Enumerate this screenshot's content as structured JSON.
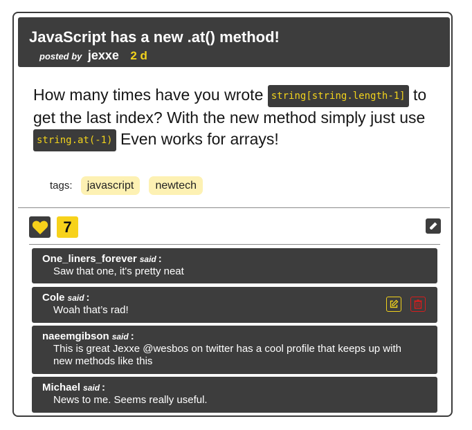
{
  "post": {
    "title": "JavaScript has a new .at() method!",
    "posted_by_label": "posted by",
    "author": "jexxe",
    "time_ago": "2 d",
    "body": {
      "part1": "How many times have you wrote ",
      "code1": "string[string.length-1]",
      "part2": " to get the last index? With the new method simply just use ",
      "code2": "string.at(-1)",
      "part3": " Even works for arrays!"
    },
    "tags_label": "tags:",
    "tags": [
      "javascript",
      "newtech"
    ],
    "likes": "7"
  },
  "comments": [
    {
      "name": "One_liners_forever",
      "said": "said",
      "colon": ":",
      "text": "Saw that one, it's pretty neat"
    },
    {
      "name": "Cole",
      "said": "said",
      "colon": ":",
      "text": "Woah that’s rad!"
    },
    {
      "name": "naeemgibson",
      "said": "said",
      "colon": ":",
      "text": "This is great Jexxe @wesbos on twitter has a cool profile that keeps up with new methods like this"
    },
    {
      "name": "Michael",
      "said": "said",
      "colon": ":",
      "text": "News to me. Seems really useful."
    }
  ],
  "colors": {
    "dark": "#3d3d3d",
    "accent_yellow": "#f2d31c",
    "tag_bg": "#fdf1b3",
    "delete_red": "#d81d1d"
  },
  "icons": {
    "like": "heart-icon",
    "edit_post": "pencil-icon",
    "edit_comment": "edit-icon",
    "delete_comment": "trash-icon"
  }
}
